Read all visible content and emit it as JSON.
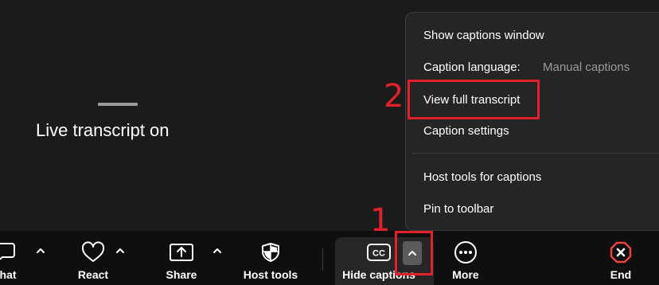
{
  "video": {
    "transcript_status": "Live transcript on"
  },
  "toolbar": {
    "chat_label": "Chat",
    "react_label": "React",
    "share_label": "Share",
    "host_tools_label": "Host tools",
    "hide_captions_label": "Hide captions",
    "more_label": "More",
    "end_label": "End",
    "captions_icon_text": "CC"
  },
  "menu": {
    "show_captions_window": "Show captions window",
    "caption_language_label": "Caption language:",
    "caption_language_value": "Manual captions",
    "view_full_transcript": "View full transcript",
    "caption_settings": "Caption settings",
    "host_tools_for_captions": "Host tools for captions",
    "pin_to_toolbar": "Pin to toolbar"
  },
  "annotations": {
    "step1": "1",
    "step2": "2"
  },
  "colors": {
    "annotation_red": "#e0202a",
    "end_red": "#e8453c",
    "background": "#1b1b1b",
    "toolbar": "#0f0f0f",
    "menu": "#252525"
  },
  "icons": {
    "chat": "chat-bubble-icon",
    "react": "heart-icon",
    "share": "share-screen-icon",
    "host_tools": "shield-icon",
    "captions": "closed-captions-icon",
    "more": "more-dots-icon",
    "end": "end-call-icon",
    "caret": "chevron-up-icon"
  }
}
